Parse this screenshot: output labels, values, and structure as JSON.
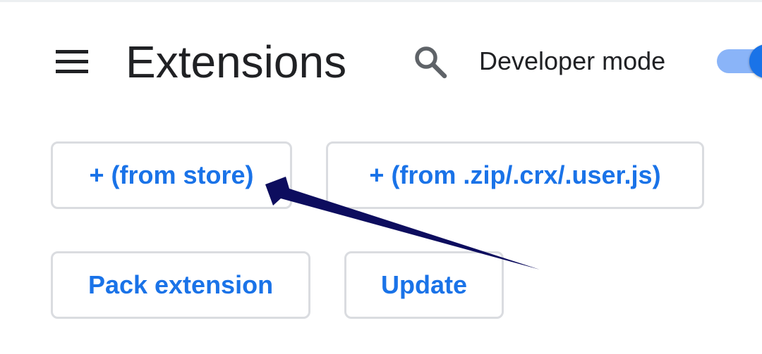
{
  "header": {
    "menu_icon": "hamburger-menu-icon",
    "title": "Extensions",
    "search_icon": "search-icon",
    "developer_mode_label": "Developer mode",
    "developer_mode_on": true
  },
  "actions": {
    "from_store_label": "+ (from store)",
    "from_file_label": "+ (from .zip/.crx/.user.js)",
    "pack_extension_label": "Pack extension",
    "update_label": "Update"
  },
  "annotation": {
    "arrow_icon": "annotation-arrow-icon",
    "arrow_color": "#0d0d5e"
  },
  "colors": {
    "accent": "#1a73e8",
    "toggle_track": "#8ab4f8",
    "text": "#202124",
    "border": "#dadce0"
  }
}
